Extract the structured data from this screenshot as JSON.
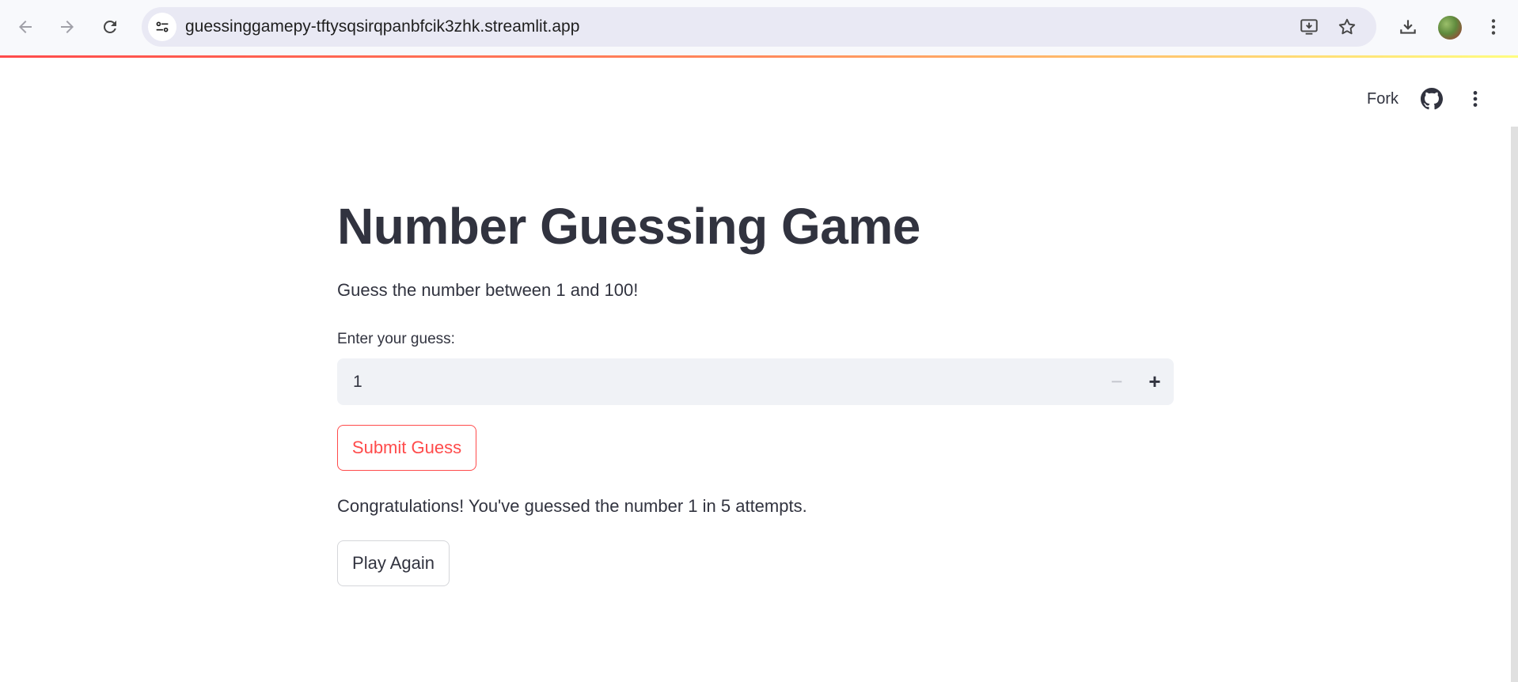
{
  "browser": {
    "url": "guessinggamepy-tftysqsirqpanbfcik3zhk.streamlit.app"
  },
  "header": {
    "fork_label": "Fork"
  },
  "main": {
    "title": "Number Guessing Game",
    "subtitle": "Guess the number between 1 and 100!",
    "input_label": "Enter your guess:",
    "input_value": "1",
    "minus_symbol": "−",
    "plus_symbol": "+",
    "submit_label": "Submit Guess",
    "result_message": "Congratulations! You've guessed the number 1 in 5 attempts.",
    "play_again_label": "Play Again"
  },
  "colors": {
    "primary": "#ff4b4b",
    "text": "#31333f",
    "input_bg": "#f0f2f6"
  }
}
